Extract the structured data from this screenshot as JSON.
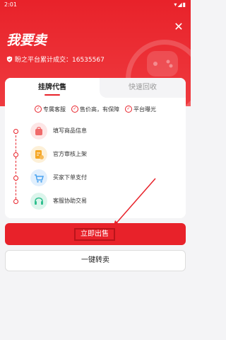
{
  "status_bar": {
    "time": "2:01",
    "icons": "▾◢▮"
  },
  "header": {
    "title": "我要卖",
    "stats_text": "盼之平台累计成交：16535567"
  },
  "tabs": [
    {
      "label": "挂牌代售",
      "active": true
    },
    {
      "label": "快速回收",
      "active": false
    }
  ],
  "features": [
    {
      "label": "专属客服"
    },
    {
      "label": "售价高，有保障"
    },
    {
      "label": "平台曝光"
    }
  ],
  "steps": [
    {
      "label": "填写商品信息",
      "icon": "bag-icon",
      "color": "#f06a6a",
      "bg": "#fde6e6"
    },
    {
      "label": "官方审核上架",
      "icon": "document-check-icon",
      "color": "#f5a623",
      "bg": "#fdf0d8"
    },
    {
      "label": "买家下单支付",
      "icon": "cart-icon",
      "color": "#4aa3f0",
      "bg": "#e1effd"
    },
    {
      "label": "客服协助交易",
      "icon": "headset-icon",
      "color": "#2fbf8f",
      "bg": "#dcf5ec"
    }
  ],
  "buttons": {
    "sell": "立即出售",
    "resell": "一键转卖"
  },
  "colors": {
    "primary": "#e8222a"
  }
}
